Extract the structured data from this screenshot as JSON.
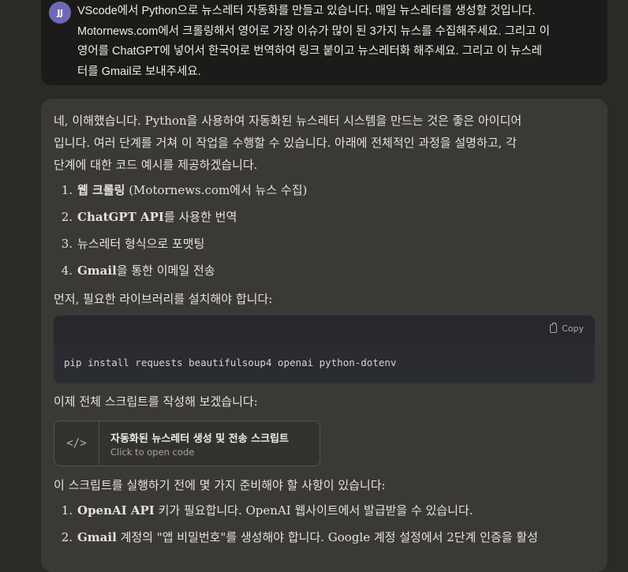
{
  "user_message": {
    "avatar_initials": "JJ",
    "lines": [
      "VScode에서 Python으로 뉴스레터 자동화를 만들고 있습니다. 매일 뉴스레터를 생성할 것입니다.",
      "Motornews.com에서 크롤링해서 영어로 가장 이슈가 많이 된 3가지 뉴스를 수집해주세요. 그리고 이",
      "영어를 ChatGPT에 넣어서 한국어로 번역하여 링크 붙이고 뉴스레터화 해주세요. 그리고 이 뉴스레",
      "터를 Gmail로 보내주세요."
    ]
  },
  "assistant": {
    "intro_lines": [
      "네, 이해했습니다. Python을 사용하여 자동화된 뉴스레터 시스템을 만드는 것은 좋은 아이디어",
      "입니다. 여러 단계를 거쳐 이 작업을 수행할 수 있습니다. 아래에 전체적인 과정을 설명하고, 각",
      "단계에 대한 코드 예시를 제공하겠습니다."
    ],
    "steps": [
      {
        "num": "1.",
        "bold": "웹 크롤링",
        "rest": " (Motornews.com에서 뉴스 수집)"
      },
      {
        "num": "2.",
        "bold": "ChatGPT API",
        "rest": "를 사용한 번역"
      },
      {
        "num": "3.",
        "bold": "뉴스레터 형식으로 포맷팅",
        "rest": ""
      },
      {
        "num": "4.",
        "bold": "Gmail",
        "rest": "을 통한 이메일 전송"
      }
    ],
    "install_intro": "먼저, 필요한 라이브러리를 설치해야 합니다:",
    "code_block": {
      "copy_label": "Copy",
      "code": "pip install requests beautifulsoup4 openai python-dotenv"
    },
    "script_intro": "이제 전체 스크립트를 작성해 보겠습니다:",
    "artifact": {
      "icon": "</>",
      "title": "자동화된 뉴스레터 생성 및 전송 스크립트",
      "subtitle": "Click to open code"
    },
    "prep_intro": "이 스크립트를 실행하기 전에 몇 가지 준비해야 할 사항이 있습니다:",
    "prep_steps": [
      {
        "num": "1.",
        "bold": "OpenAI API",
        "rest": " 키가 필요합니다. OpenAI 웹사이트에서 발급받을 수 있습니다."
      },
      {
        "num": "2.",
        "bold": "Gmail",
        "rest": " 계정의 \"앱 비밀번호\"를 생성해야 합니다. Google 계정 설정에서 2단계 인증을 활성"
      }
    ]
  },
  "colors": {
    "background": "#2b2a27",
    "user_bubble": "#1c1b19",
    "assistant_bubble": "#3a3935",
    "avatar": "#6e68b5",
    "code_bg": "#2a2c31"
  }
}
